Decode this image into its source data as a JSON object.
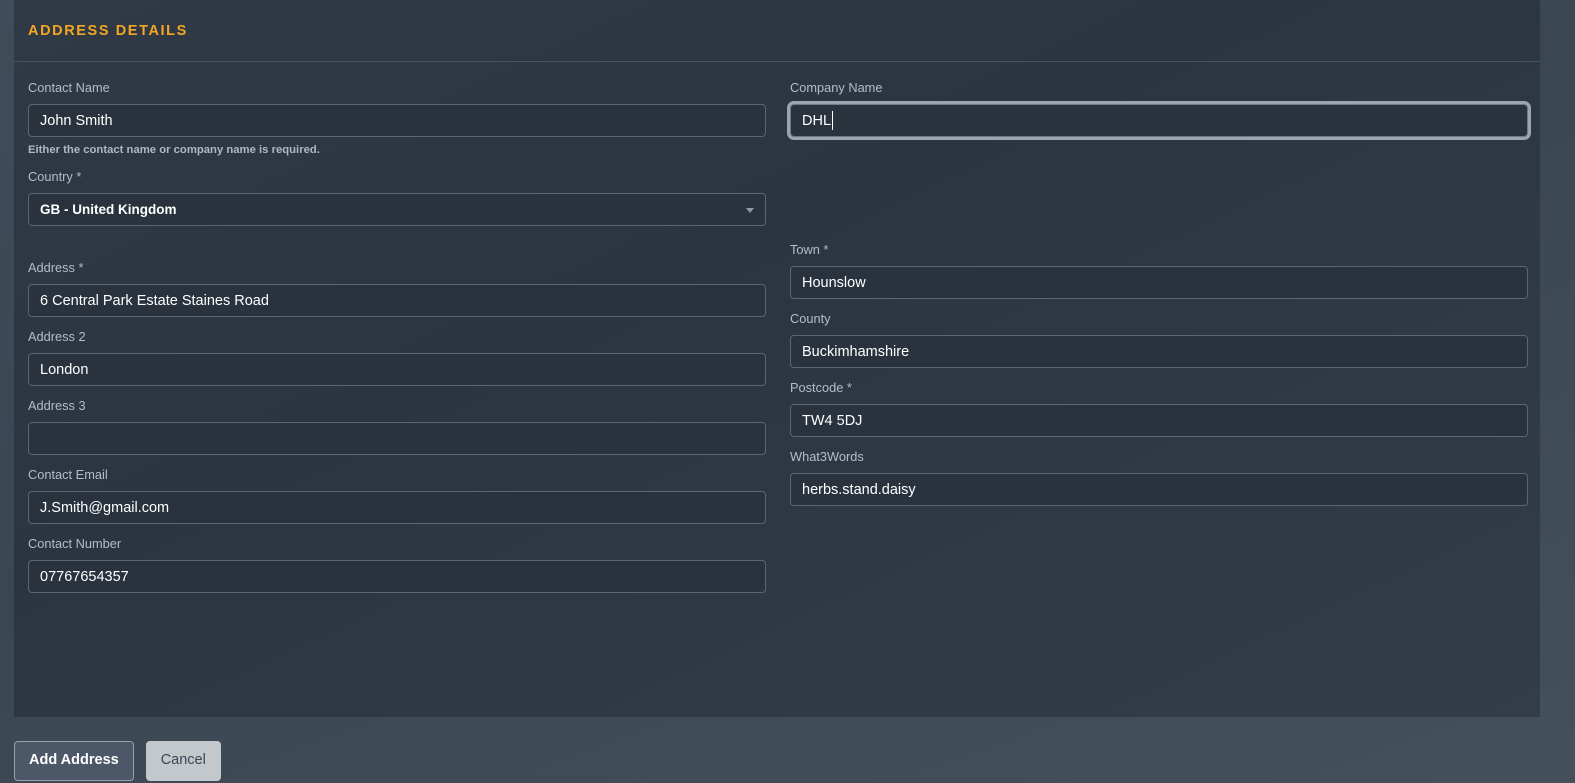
{
  "panel": {
    "title": "Address Details"
  },
  "form": {
    "contact_name": {
      "label": "Contact Name",
      "value": "John Smith",
      "placeholder": "",
      "helper": "Either the contact name or company name is required."
    },
    "company_name": {
      "label": "Company Name",
      "value": "DHL",
      "placeholder": ""
    },
    "country": {
      "label": "Country *",
      "value": "GB - United Kingdom",
      "options": [
        "GB - United Kingdom"
      ]
    },
    "address": {
      "label": "Address *",
      "value": "6 Central Park Estate Staines Road",
      "placeholder": ""
    },
    "address2": {
      "label": "Address 2",
      "value": "London",
      "placeholder": ""
    },
    "address3": {
      "label": "Address 3",
      "value": "",
      "placeholder": ""
    },
    "contact_email": {
      "label": "Contact Email",
      "value": "J.Smith@gmail.com",
      "placeholder": ""
    },
    "contact_number": {
      "label": "Contact Number",
      "value": "07767654357",
      "placeholder": ""
    },
    "town": {
      "label": "Town *",
      "value": "Hounslow",
      "placeholder": ""
    },
    "county": {
      "label": "County",
      "value": "Buckimhamshire",
      "placeholder": ""
    },
    "postcode": {
      "label": "Postcode *",
      "value": "TW4 5DJ",
      "placeholder": ""
    },
    "what3words": {
      "label": "What3Words",
      "value": "herbs.stand.daisy",
      "placeholder": ""
    }
  },
  "footer": {
    "submit_label": "Add Address",
    "cancel_label": "Cancel"
  },
  "colors": {
    "accent": "#f5a623",
    "panel_bg": "#2f3a46",
    "page_bg": "#3d4a57",
    "input_bg": "#29323d",
    "input_border": "#5a6672",
    "label": "#b3bdc7",
    "focus_ring": "#9aa5b0",
    "primary_button_bg": "#4c5868",
    "secondary_button_bg": "#c3c8cd"
  }
}
